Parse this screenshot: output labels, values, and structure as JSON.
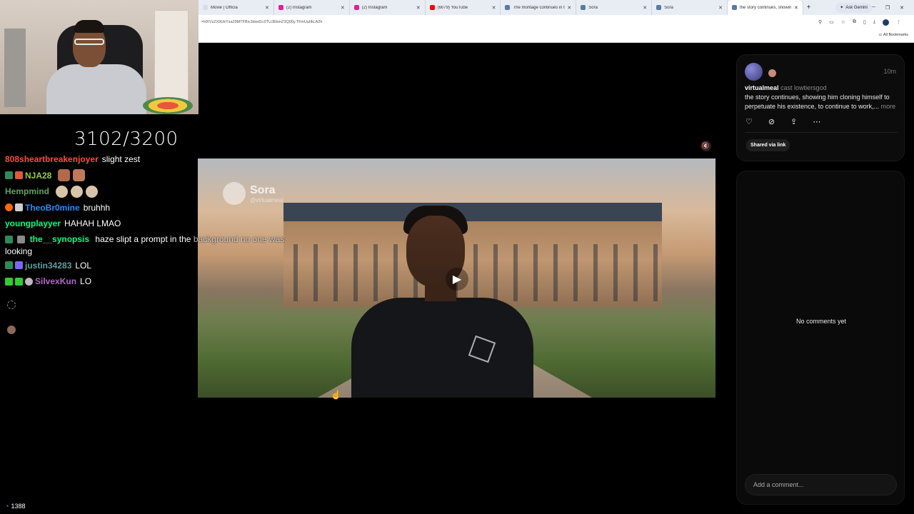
{
  "browser": {
    "tabs": [
      {
        "title": "Movie | Officia",
        "color": "#d9dde3"
      },
      {
        "title": "(2) Instagram",
        "color": "#d6249f"
      },
      {
        "title": "(2) Instagram",
        "color": "#d6249f"
      },
      {
        "title": "(6079) YouTube",
        "color": "#ff0000"
      },
      {
        "title": "The montage continues in t",
        "color": "#5a7aa8"
      },
      {
        "title": "Sora",
        "color": "#5a7aa8"
      },
      {
        "title": "Sora",
        "color": "#5a7aa8"
      },
      {
        "title": "the story continues, showin",
        "color": "#5a7aa8",
        "active": true
      }
    ],
    "new_tab": "+",
    "ask_gemini": "Ask Gemini",
    "url": "=HXVzZXItUkYza29MTFBic3dwd1c0TUJEbmZ3Q00y.TFmUuIlkLA2h",
    "all_bookmarks": "All Bookmarks"
  },
  "stream": {
    "follower_goal": "3102/3200",
    "chat": [
      {
        "user": "808sheartbreakenjoyer",
        "color": "#ff4b3e",
        "text": "slight zest",
        "badges": [],
        "emotes": 0
      },
      {
        "user": "NJA28",
        "color": "#9acd32",
        "text": "",
        "badges": [
          "#2e8b57",
          "#e05a3a"
        ],
        "emotes": 2
      },
      {
        "user": "Hempmind",
        "color": "#5fa35f",
        "text": "",
        "badges": [],
        "emotes": 3
      },
      {
        "user": "TheoBr0mine",
        "color": "#1e90ff",
        "text": "bruhhh",
        "badges": [
          "#ff6a00",
          "#cfcfcf"
        ],
        "emotes": 0
      },
      {
        "user": "youngplayyer",
        "color": "#00ff7f",
        "text": "HAHAH LMAO",
        "badges": [],
        "emotes": 0
      },
      {
        "user": "the__synopsis",
        "color": "#00ff7f",
        "text": "haze slipt a prompt in the",
        "text_over_video": "background no one was",
        "text_wrap": "looking",
        "badges": [
          "#2e8b57",
          "#8a8a8a"
        ],
        "emotes": 0
      },
      {
        "user": "justin34283",
        "color": "#5f9ea0",
        "text": "LOL",
        "badges": [
          "#2e8b57",
          "#7b68ee"
        ],
        "emotes": 0
      },
      {
        "user": "SilvexKun",
        "color": "#b069c9",
        "text": "LO",
        "badges": [
          "#32cd32",
          "#32cd32",
          "#bbbbbb"
        ],
        "emotes": 0
      }
    ],
    "view_count": "1388"
  },
  "video": {
    "watermark_brand": "Sora",
    "watermark_handle": "@virtualmeal",
    "play_icon": "play-icon",
    "mute_icon": "speaker-muted-icon"
  },
  "post": {
    "username": "virtualmeal",
    "cast": "cast lowtiersgod",
    "time": "10m",
    "text": "the story continues, showing him cloning himself to perpetuate his existence, to continue to work,...",
    "more": "more",
    "actions": [
      "heart-icon",
      "remix-icon",
      "share-icon",
      "more-icon"
    ],
    "shared_label": "Shared via link"
  },
  "comments": {
    "empty_text": "No comments yet",
    "input_placeholder": "Add a comment..."
  },
  "colors": {
    "background": "#000000",
    "card": "#0c0c0c",
    "accent_text": "#eaeaea"
  }
}
